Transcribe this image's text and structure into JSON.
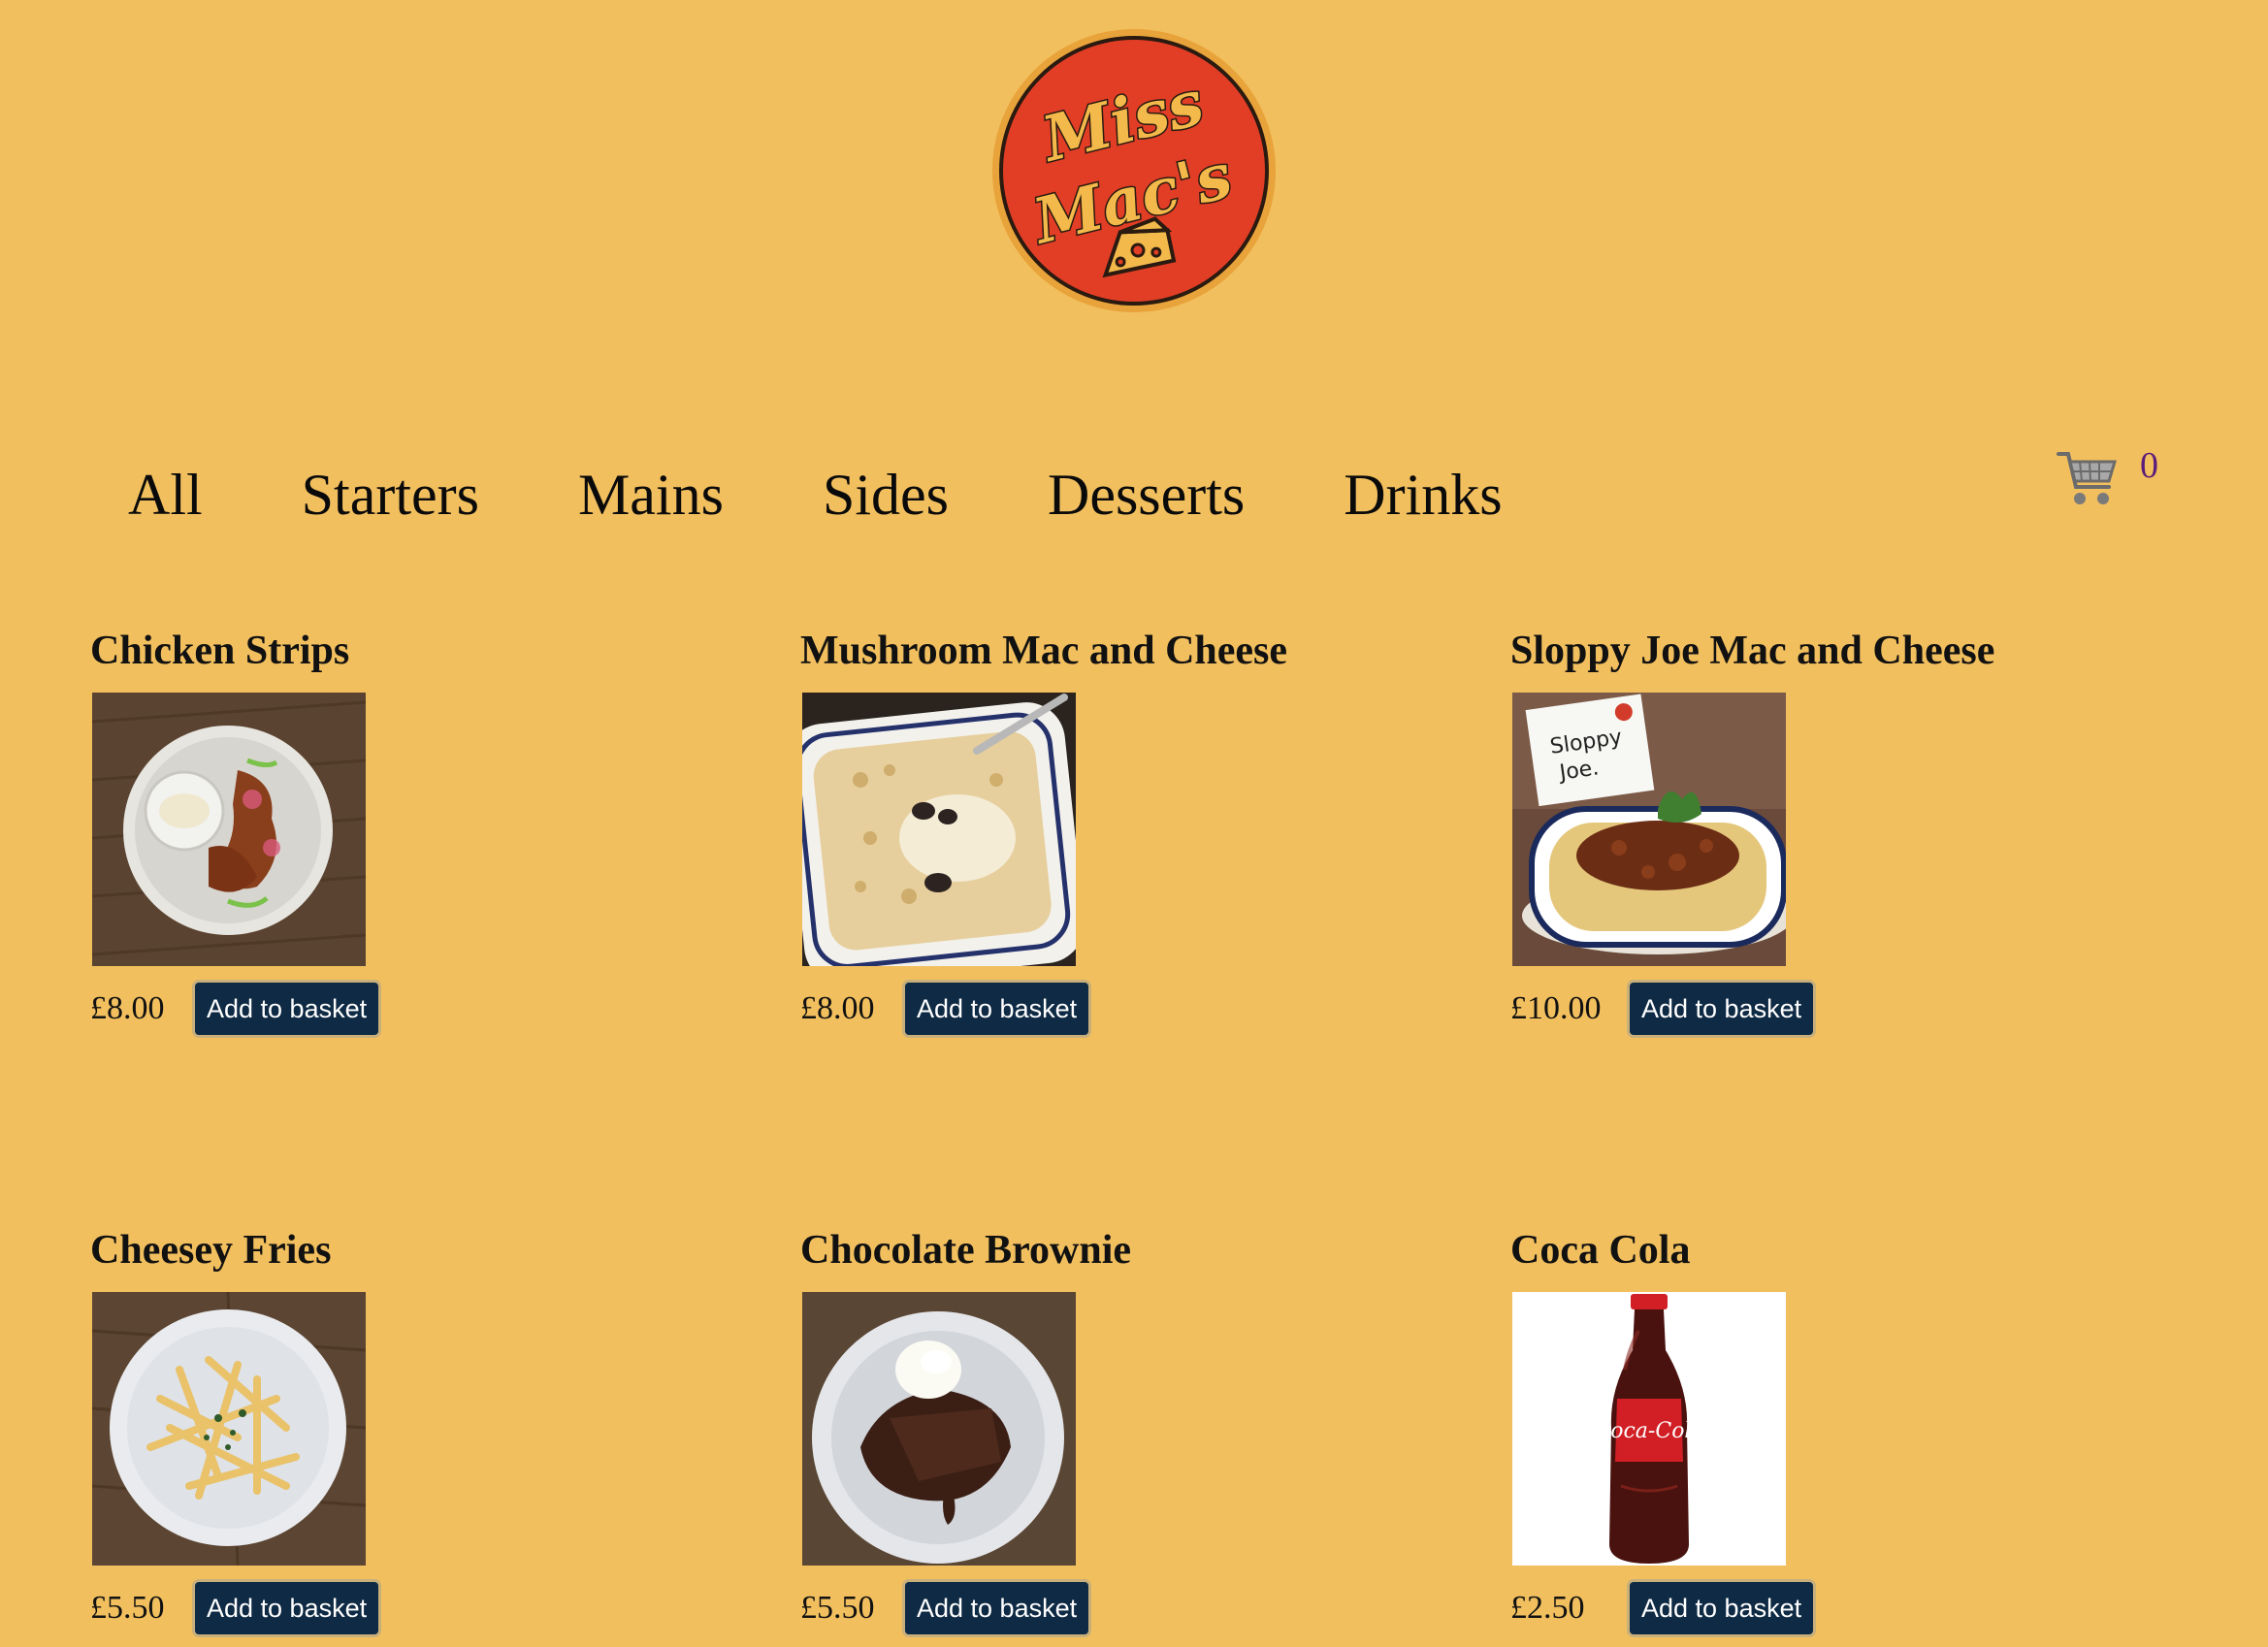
{
  "brand": {
    "logo_text": "Miss Mac's"
  },
  "nav": {
    "items": [
      "All",
      "Starters",
      "Mains",
      "Sides",
      "Desserts",
      "Drinks"
    ]
  },
  "cart": {
    "icon": "shopping-cart-icon",
    "count": "0"
  },
  "products": [
    {
      "name": "Chicken Strips",
      "price": "£8.00",
      "button": "Add to basket",
      "image": "chicken-strips-photo"
    },
    {
      "name": "Mushroom Mac and Cheese",
      "price": "£8.00",
      "button": "Add to basket",
      "image": "mushroom-mac-photo"
    },
    {
      "name": "Sloppy Joe Mac and Cheese",
      "price": "£10.00",
      "button": "Add to basket",
      "image": "sloppy-joe-photo",
      "sign_text": "Sloppy Joe."
    },
    {
      "name": "Cheesey Fries",
      "price": "£5.50",
      "button": "Add to basket",
      "image": "cheesey-fries-photo"
    },
    {
      "name": "Chocolate Brownie",
      "price": "£5.50",
      "button": "Add to basket",
      "image": "chocolate-brownie-photo"
    },
    {
      "name": "Coca Cola",
      "price": "£2.50",
      "button": "Add to basket",
      "image": "coca-cola-photo",
      "label_text": "Coca-Cola"
    }
  ],
  "colors": {
    "background": "#F2BF5E",
    "button": "#0F2A44",
    "logo_red": "#E23E26",
    "cart_count": "#5b1d7a"
  }
}
